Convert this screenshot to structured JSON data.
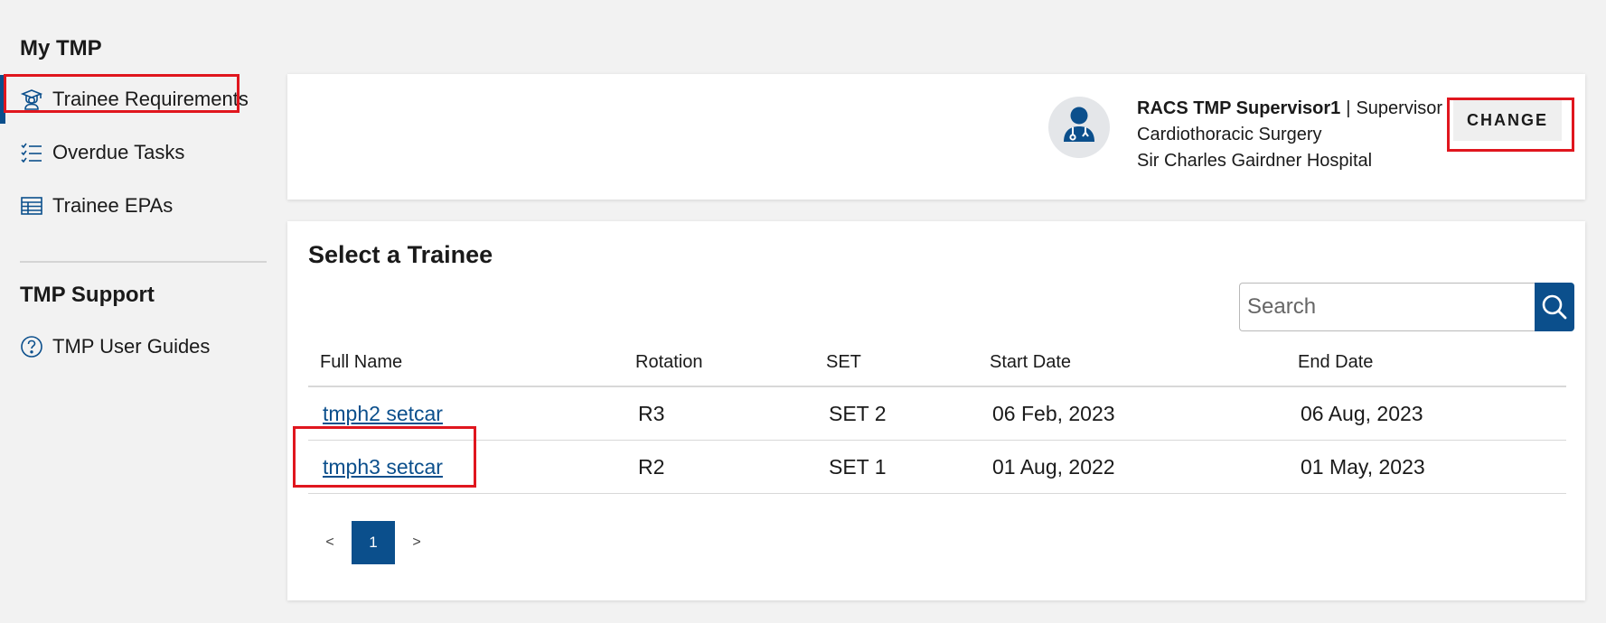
{
  "sidebar": {
    "section1_title": "My TMP",
    "section2_title": "TMP Support",
    "items": [
      {
        "label": "Trainee Requirements",
        "icon": "graduate-icon"
      },
      {
        "label": "Overdue Tasks",
        "icon": "checklist-icon"
      },
      {
        "label": "Trainee EPAs",
        "icon": "table-icon"
      },
      {
        "label": "TMP User Guides",
        "icon": "help-circle-icon"
      }
    ]
  },
  "supervisor": {
    "name": "RACS TMP Supervisor1",
    "separator": "|",
    "role": "Supervisor",
    "specialty": "Cardiothoracic Surgery",
    "hospital": "Sir Charles Gairdner Hospital",
    "change_label": "CHANGE"
  },
  "trainees": {
    "title": "Select a Trainee",
    "search_placeholder": "Search",
    "columns": [
      "Full Name",
      "Rotation",
      "SET",
      "Start Date",
      "End Date"
    ],
    "rows": [
      {
        "name": "tmph2 setcar",
        "rotation": "R3",
        "set": "SET 2",
        "start": "06 Feb, 2023",
        "end": "06 Aug, 2023"
      },
      {
        "name": "tmph3 setcar",
        "rotation": "R2",
        "set": "SET 1",
        "start": "01 Aug, 2022",
        "end": "01 May, 2023"
      }
    ]
  },
  "pagination": {
    "prev": "<",
    "current": "1",
    "next": ">"
  },
  "colors": {
    "accent": "#0b4f8c",
    "highlight": "#e0161e",
    "background": "#f2f2f2"
  }
}
